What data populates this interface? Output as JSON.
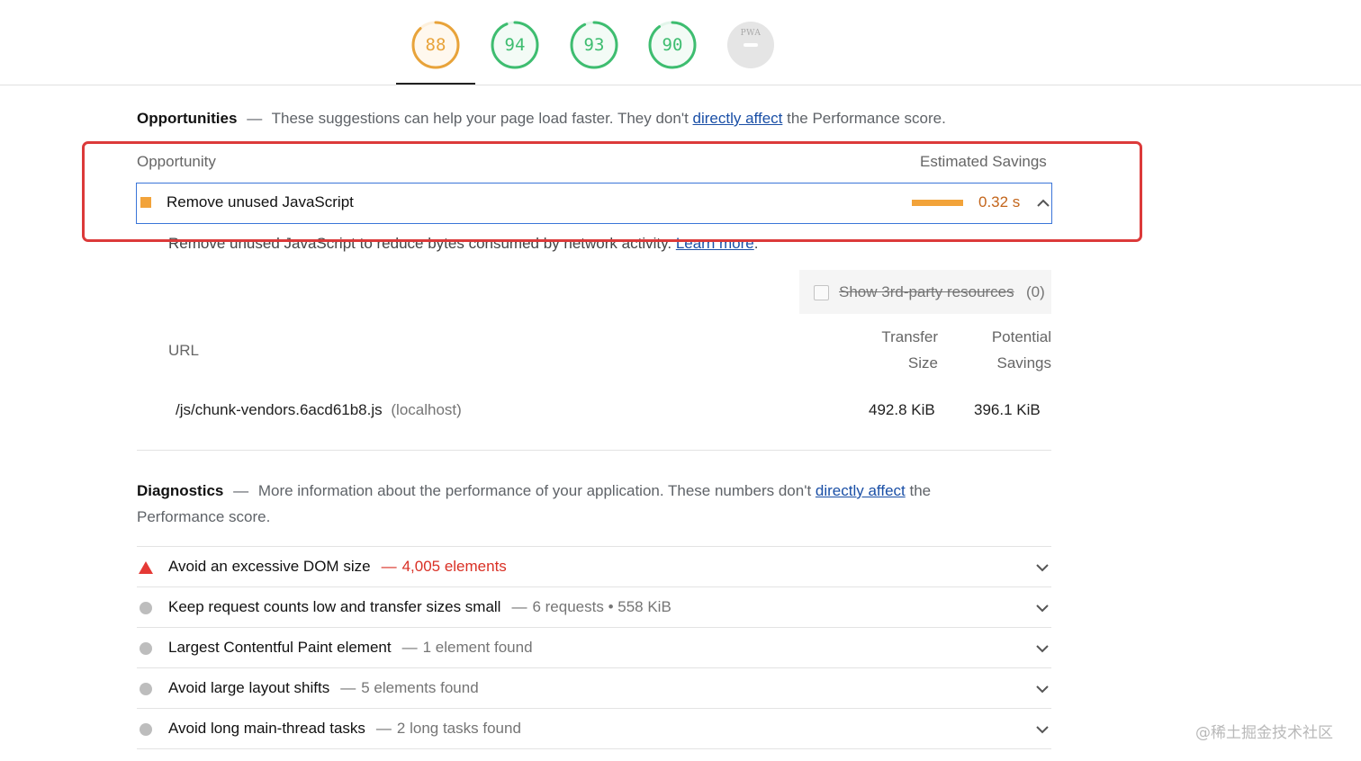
{
  "scores": [
    {
      "value": "88",
      "color": "#e8a33a",
      "level": 0.88,
      "active": true
    },
    {
      "value": "94",
      "color": "#3ebd70",
      "level": 0.94,
      "active": false
    },
    {
      "value": "93",
      "color": "#3ebd70",
      "level": 0.93,
      "active": false
    },
    {
      "value": "90",
      "color": "#3ebd70",
      "level": 0.9,
      "active": false
    }
  ],
  "pwa": {
    "label": "PWA"
  },
  "opportunities": {
    "title": "Opportunities",
    "dash": "—",
    "desc_before": "These suggestions can help your page load faster. They don't",
    "link": "directly affect",
    "desc_after": "the Performance score.",
    "col_opportunity": "Opportunity",
    "col_savings": "Estimated Savings",
    "item": {
      "label": "Remove unused JavaScript",
      "savings": "0.32 s",
      "marker_color": "#f2a33a",
      "description": "Remove unused JavaScript to reduce bytes consumed by network activity.",
      "learn_more": "Learn more",
      "period": ".",
      "third_party_label": "Show 3rd-party resources",
      "third_party_count": "(0)",
      "col_url": "URL",
      "col_transfer_1": "Transfer",
      "col_transfer_2": "Size",
      "col_potential_1": "Potential",
      "col_potential_2": "Savings",
      "rows": [
        {
          "url": "/js/chunk-vendors.6acd61b8.js",
          "host": "(localhost)",
          "transfer": "492.8 KiB",
          "potential": "396.1 KiB"
        }
      ]
    }
  },
  "diagnostics": {
    "title": "Diagnostics",
    "dash": "—",
    "desc_before": "More information about the performance of your application. These numbers don't",
    "link": "directly affect",
    "desc_after": "the",
    "desc_line2": "Performance score.",
    "items": [
      {
        "title": "Avoid an excessive DOM size",
        "value": "4,005 elements",
        "status": "fail"
      },
      {
        "title": "Keep request counts low and transfer sizes small",
        "value": "6 requests • 558 KiB",
        "status": "info"
      },
      {
        "title": "Largest Contentful Paint element",
        "value": "1 element found",
        "status": "info"
      },
      {
        "title": "Avoid large layout shifts",
        "value": "5 elements found",
        "status": "info"
      },
      {
        "title": "Avoid long main-thread tasks",
        "value": "2 long tasks found",
        "status": "info"
      }
    ],
    "sep": "—"
  },
  "watermark": "@稀土掘金技术社区"
}
